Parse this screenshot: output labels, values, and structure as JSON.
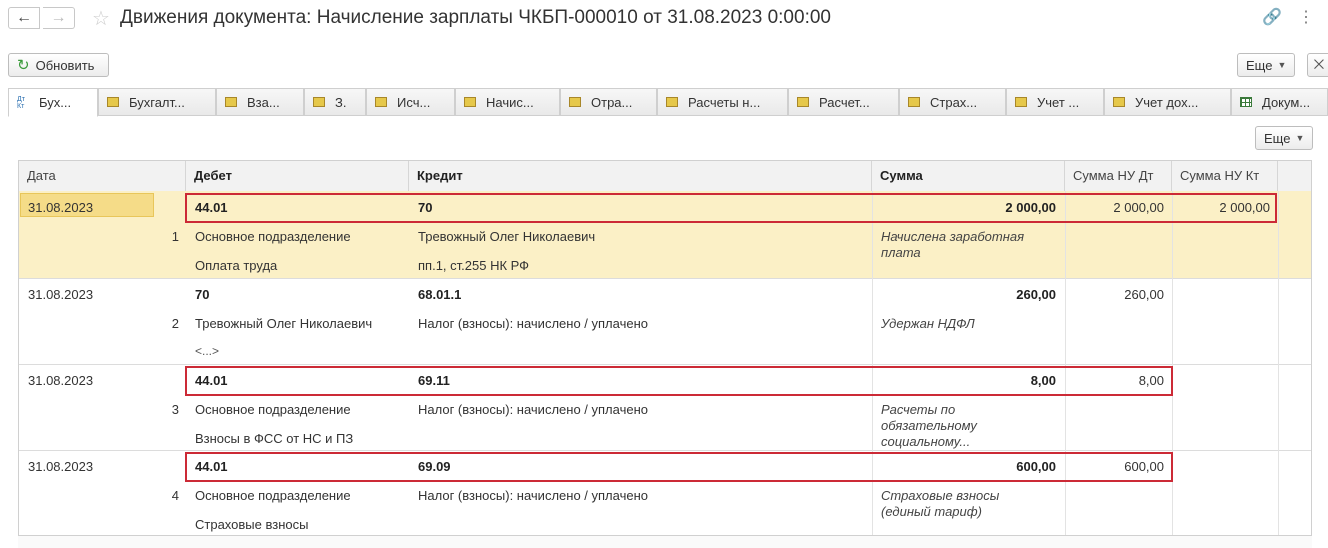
{
  "window": {
    "title": "Движения документа: Начисление зарплаты ЧКБП-000010 от 31.08.2023 0:00:00",
    "back_icon": "←",
    "forward_icon": "→",
    "star_icon": "☆",
    "link_icon": "🔗",
    "more_icon": "⋮"
  },
  "toolbar": {
    "refresh_label": "Обновить",
    "more_label": "Еще",
    "close_icon": "⨉"
  },
  "tabs": [
    {
      "label": "Бух...",
      "active": true
    },
    {
      "label": "Бухгалт..."
    },
    {
      "label": "Вза..."
    },
    {
      "label": "З."
    },
    {
      "label": "Исч..."
    },
    {
      "label": "Начис..."
    },
    {
      "label": "Отра..."
    },
    {
      "label": "Расчеты н..."
    },
    {
      "label": "Расчет..."
    },
    {
      "label": "Страх..."
    },
    {
      "label": "Учет ..."
    },
    {
      "label": "Учет дох..."
    },
    {
      "label": "Докум..."
    }
  ],
  "tab_toolbar": {
    "more_label": "Еще"
  },
  "table": {
    "columns": [
      "Дата",
      "Дебет",
      "Кредит",
      "Сумма",
      "Сумма НУ Дт",
      "Сумма НУ Кт"
    ],
    "rows": [
      {
        "date": "31.08.2023",
        "num": "1",
        "debit": "44.01",
        "debit_sub1": "Основное подразделение",
        "debit_sub2": "Оплата труда",
        "credit": "70",
        "credit_sub1": "Тревожный Олег Николаевич",
        "credit_sub2": "пп.1, ст.255 НК РФ",
        "sum": "2 000,00",
        "content1": "Начислена заработная",
        "content2": "плата",
        "content3": "",
        "nu_dt": "2 000,00",
        "nu_kt": "2 000,00"
      },
      {
        "date": "31.08.2023",
        "num": "2",
        "debit": "70",
        "debit_sub1": "Тревожный Олег Николаевич",
        "debit_sub2": "<...>",
        "credit": "68.01.1",
        "credit_sub1": "Налог (взносы): начислено / уплачено",
        "credit_sub2": "",
        "sum": "260,00",
        "content1": "Удержан НДФЛ",
        "content2": "",
        "content3": "",
        "nu_dt": "260,00",
        "nu_kt": ""
      },
      {
        "date": "31.08.2023",
        "num": "3",
        "debit": "44.01",
        "debit_sub1": "Основное подразделение",
        "debit_sub2": "Взносы в ФСС от НС и ПЗ",
        "credit": "69.11",
        "credit_sub1": "Налог (взносы): начислено / уплачено",
        "credit_sub2": "",
        "sum": "8,00",
        "content1": "Расчеты по",
        "content2": "обязательному",
        "content3": "социальному...",
        "nu_dt": "8,00",
        "nu_kt": ""
      },
      {
        "date": "31.08.2023",
        "num": "4",
        "debit": "44.01",
        "debit_sub1": "Основное подразделение",
        "debit_sub2": "Страховые взносы",
        "credit": "69.09",
        "credit_sub1": "Налог (взносы): начислено / уплачено",
        "credit_sub2": "",
        "sum": "600,00",
        "content1": "Страховые взносы",
        "content2": "(единый тариф)",
        "content3": "",
        "nu_dt": "600,00",
        "nu_kt": ""
      }
    ]
  },
  "colors": {
    "highlight": "#cc2a36",
    "selected_row": "#fbf0c6"
  }
}
